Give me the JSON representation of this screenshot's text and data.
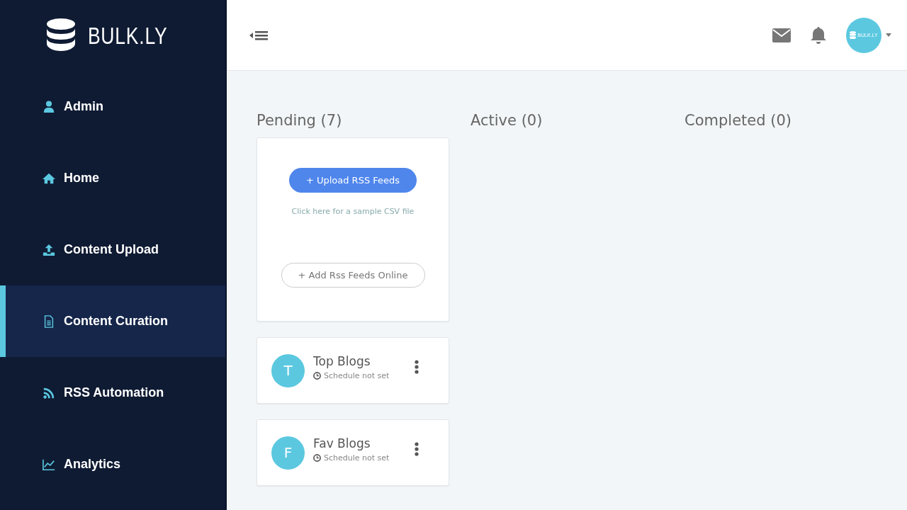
{
  "brand": {
    "name": "BULK.LY"
  },
  "sidebar": {
    "items": [
      {
        "label": "Admin",
        "kind": "user",
        "selected": false
      },
      {
        "label": "Home",
        "kind": "home",
        "selected": false
      },
      {
        "label": "Content Upload",
        "kind": "upload",
        "selected": false
      },
      {
        "label": "Content Curation",
        "kind": "file",
        "selected": true
      },
      {
        "label": "RSS Automation",
        "kind": "rss",
        "selected": false
      },
      {
        "label": "Analytics",
        "kind": "chart",
        "selected": false
      }
    ]
  },
  "header": {
    "avatar_text": "BULK.LY"
  },
  "columns": [
    {
      "title": "Pending (7)",
      "upload": {
        "primary_button": "+ Upload RSS Feeds",
        "sample_link": "Click here for a sample CSV file",
        "secondary_button": "+ Add Rss Feeds Online"
      },
      "feeds": [
        {
          "initial": "T",
          "name": "Top Blogs",
          "schedule": "Schedule not set"
        },
        {
          "initial": "F",
          "name": "Fav Blogs",
          "schedule": "Schedule not set"
        }
      ]
    },
    {
      "title": "Active (0)"
    },
    {
      "title": "Completed (0)"
    }
  ]
}
